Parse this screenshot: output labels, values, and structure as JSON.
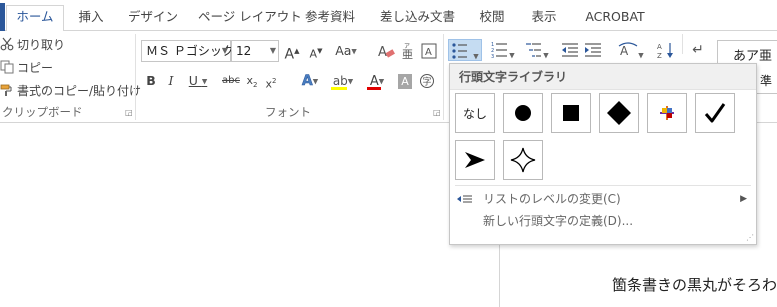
{
  "tabs": [
    {
      "label": "ホーム",
      "active": true
    },
    {
      "label": "挿入"
    },
    {
      "label": "デザイン"
    },
    {
      "label": "ページ レイアウト"
    },
    {
      "label": "参考資料"
    },
    {
      "label": "差し込み文書"
    },
    {
      "label": "校閲"
    },
    {
      "label": "表示"
    },
    {
      "label": "ACROBAT"
    }
  ],
  "clipboard": {
    "cut": "切り取り",
    "copy": "コピー",
    "format_painter": "書式のコピー/貼り付け",
    "group_label": "クリップボード"
  },
  "font": {
    "family": "ＭＳ Ｐゴシック",
    "size": "12",
    "group_label": "フォント",
    "highlight_color": "#ffff00",
    "font_color": "#e00000"
  },
  "paragraph": {
    "bullets_active": true
  },
  "styles": {
    "preview": "あア亜",
    "second": "準"
  },
  "bullet_popup": {
    "title": "行頭文字ライブラリ",
    "none_label": "なし",
    "options": [
      "none",
      "filled-circle",
      "filled-square",
      "filled-diamond",
      "color-cross",
      "checkmark",
      "arrowhead",
      "four-point-star"
    ],
    "change_level": "リストのレベルの変更(C)",
    "define_new": "新しい行頭文字の定義(D)..."
  },
  "document": {
    "visible_text": "箇条書きの黒丸がそろわ"
  }
}
